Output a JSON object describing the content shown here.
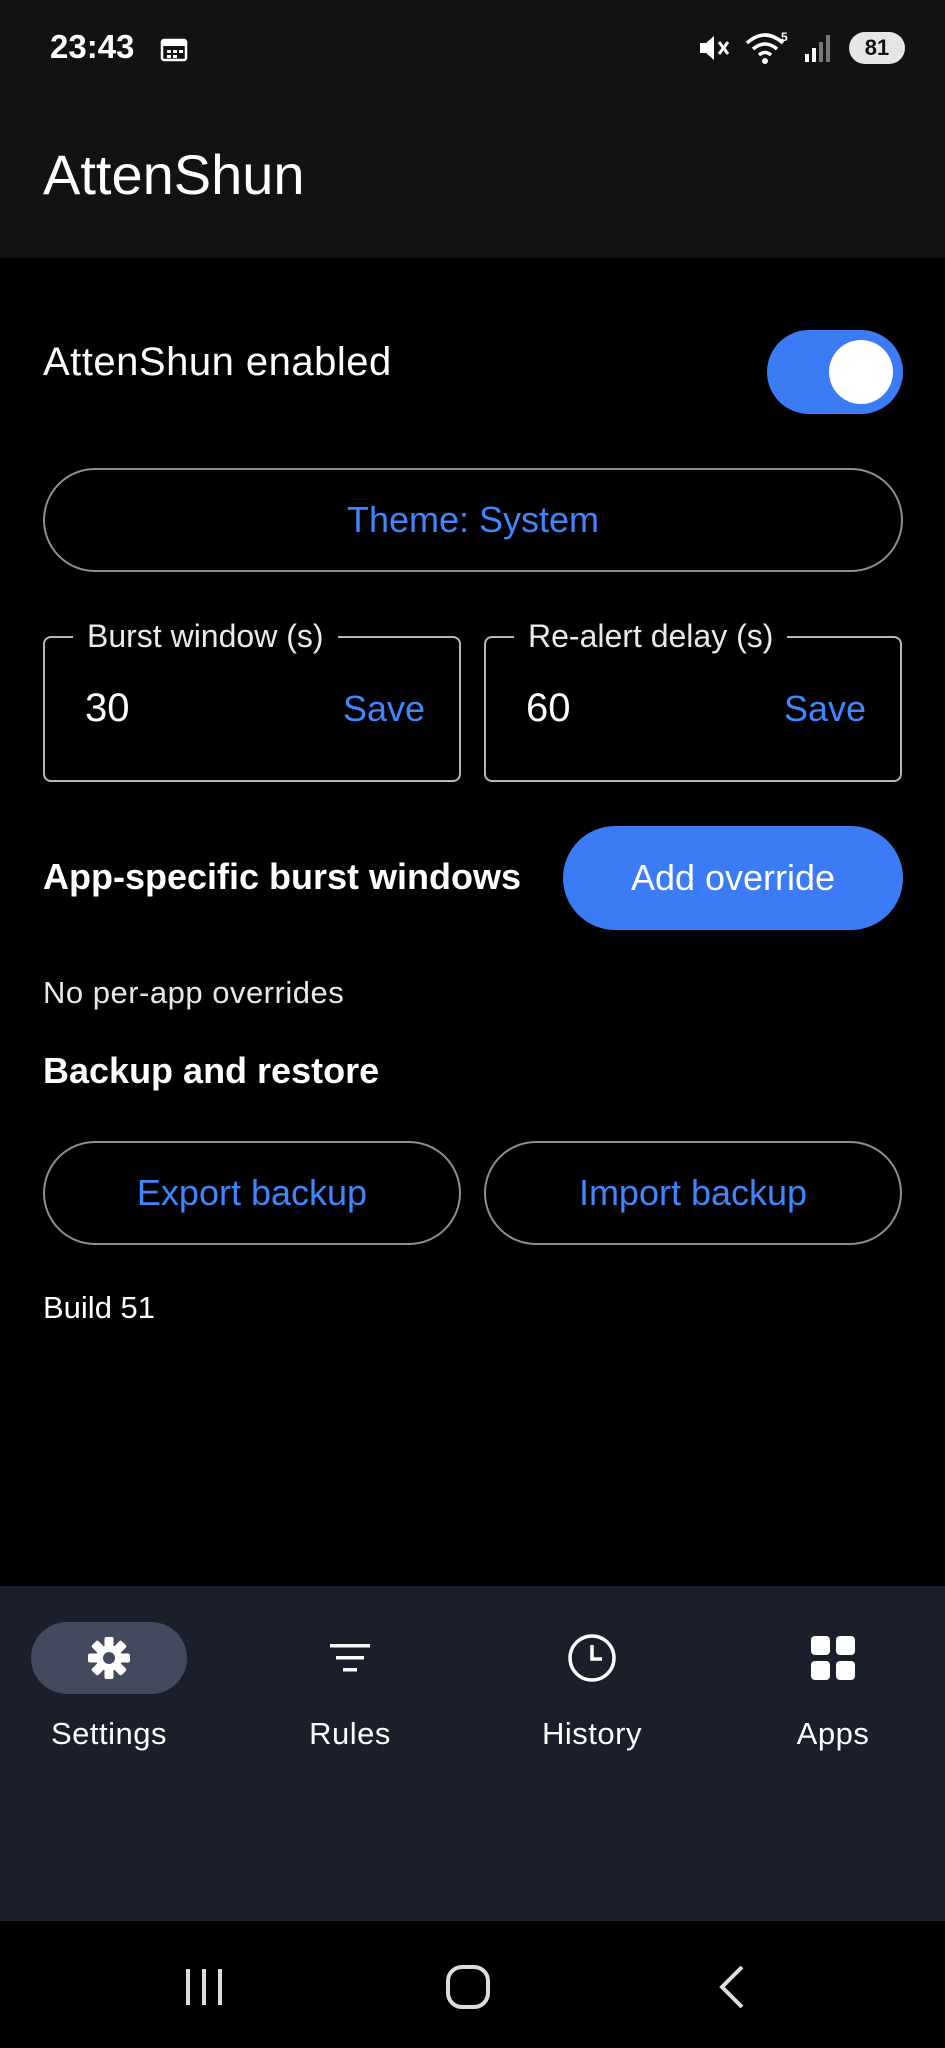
{
  "status_bar": {
    "time": "23:43",
    "battery": "81",
    "icons": [
      "calendar-icon",
      "mute-icon",
      "wifi-icon",
      "signal-icon",
      "battery-icon"
    ],
    "wifi_badge": "5"
  },
  "app_bar": {
    "title": "AttenShun"
  },
  "settings": {
    "enabled_label": "AttenShun enabled",
    "enabled": true,
    "theme_button": "Theme: System",
    "burst_window": {
      "label": "Burst window (s)",
      "value": "30",
      "save": "Save"
    },
    "realert_delay": {
      "label": "Re-alert delay (s)",
      "value": "60",
      "save": "Save"
    },
    "overrides_label": "App-specific burst windows",
    "add_override": "Add override",
    "no_overrides": "No per-app overrides",
    "backup_title": "Backup and restore",
    "export_backup": "Export backup",
    "import_backup": "Import backup",
    "build": "Build 51"
  },
  "bottom_nav": {
    "items": [
      {
        "label": "Settings",
        "icon": "gear-icon",
        "active": true
      },
      {
        "label": "Rules",
        "icon": "filter-icon",
        "active": false
      },
      {
        "label": "History",
        "icon": "clock-icon",
        "active": false
      },
      {
        "label": "Apps",
        "icon": "apps-grid-icon",
        "active": false
      }
    ]
  },
  "colors": {
    "accent": "#3b7cf6",
    "link": "#3f86ff",
    "nav_background": "#1b1e2b",
    "nav_active_pill": "#434a5e",
    "app_bar": "#121212",
    "background": "#000000"
  }
}
